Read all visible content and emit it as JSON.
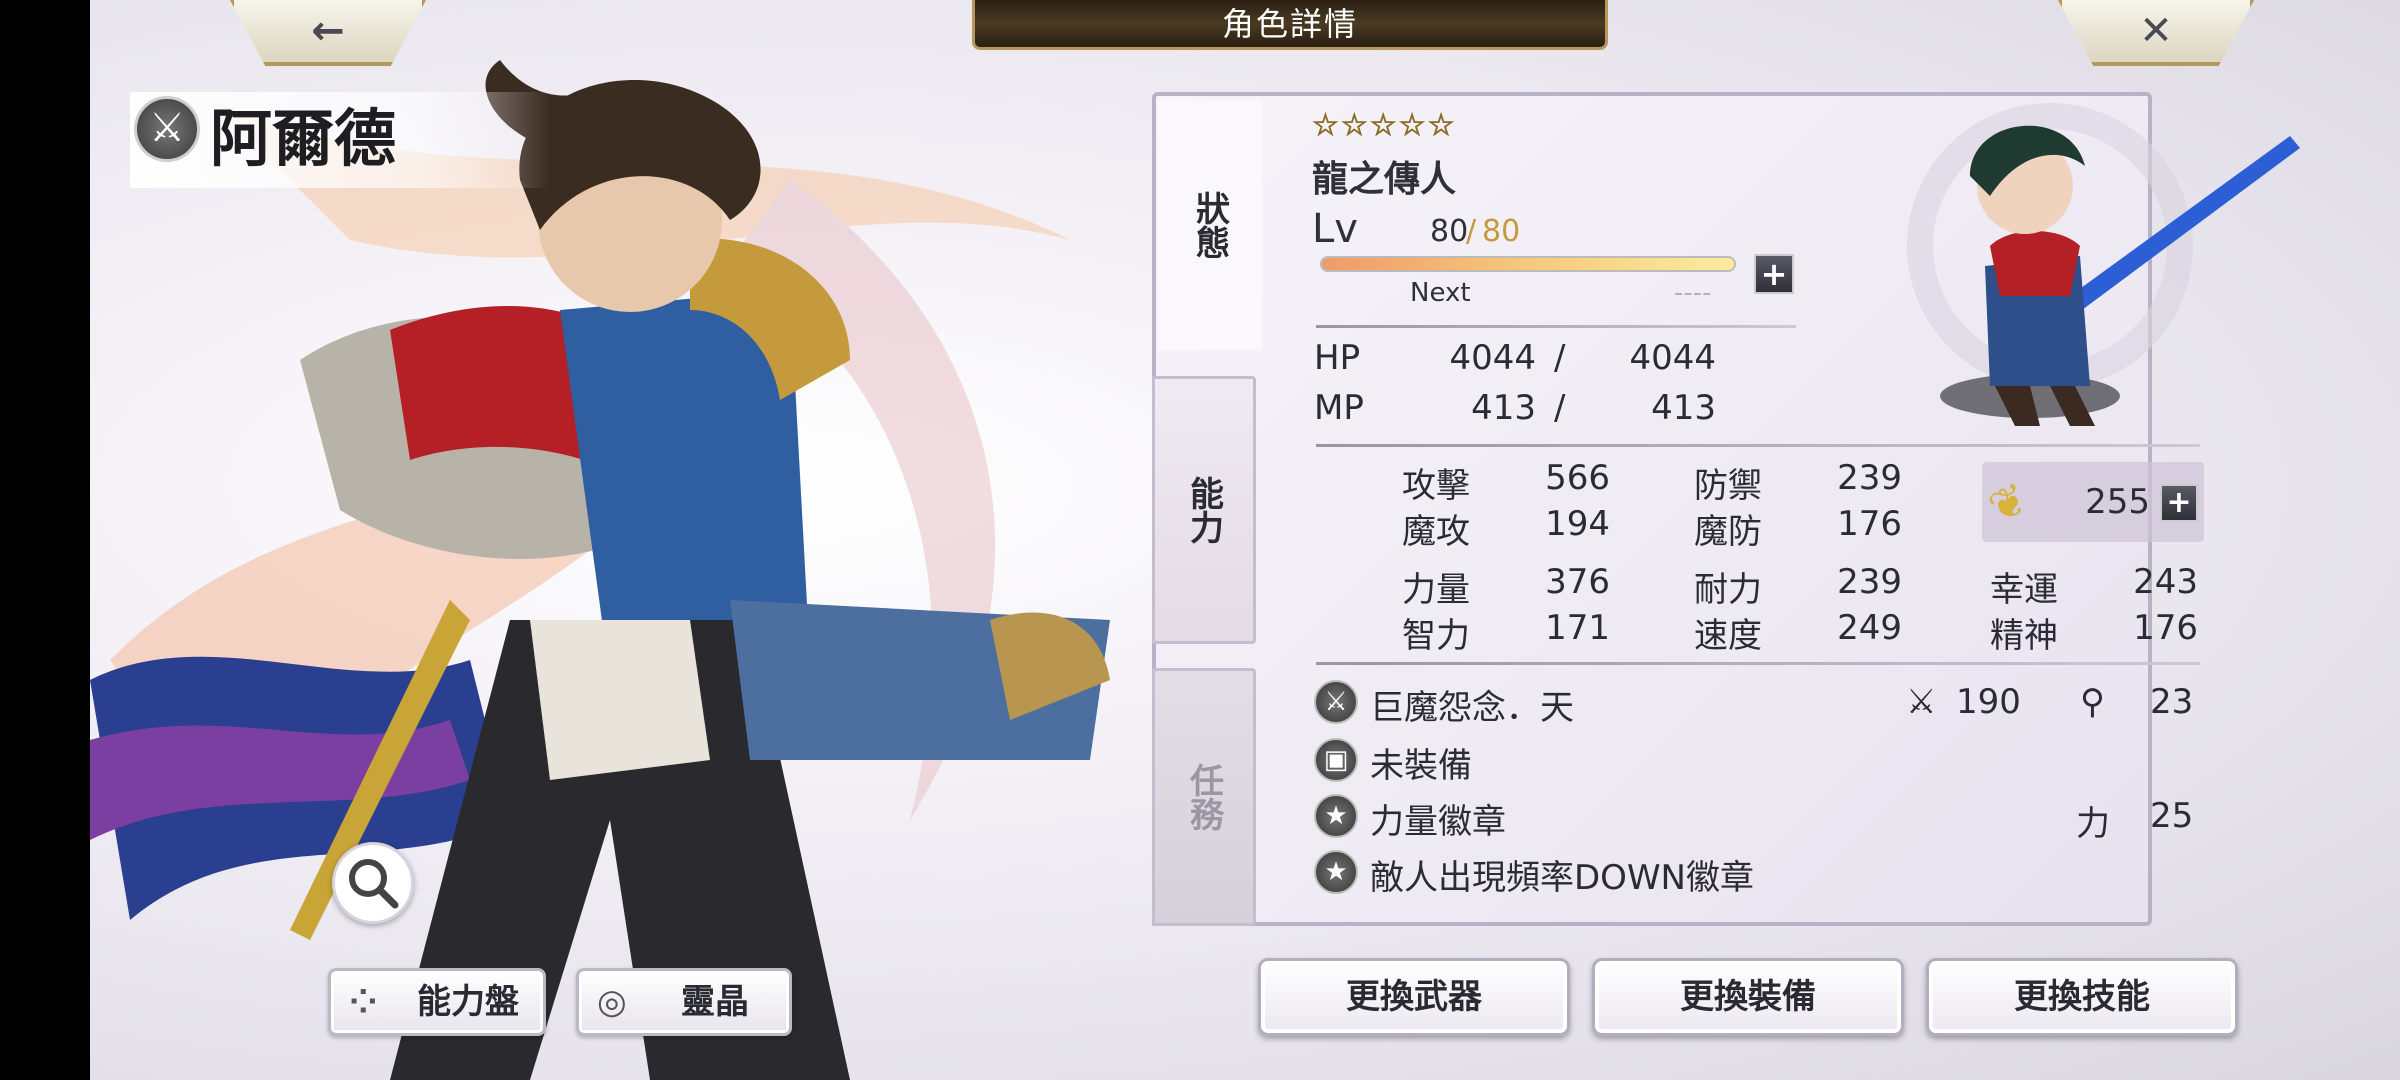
{
  "header": {
    "title": "角色詳情",
    "back_icon": "arrow-left-icon",
    "close_icon": "close-icon"
  },
  "character": {
    "name": "阿爾德",
    "rarity_stars": "☆☆☆☆☆",
    "job": "龍之傳人",
    "level_label": "Lv",
    "level_current": "80",
    "level_sep": "/",
    "level_max": "80",
    "exp_fill": 1.0,
    "next_label": "Next",
    "next_value": "----"
  },
  "tabs": {
    "status": "狀態",
    "ability": "能力",
    "quest": "任務"
  },
  "vitals": {
    "hp_label": "HP",
    "hp_current": "4044",
    "hp_sep": "/",
    "hp_max": "4044",
    "mp_label": "MP",
    "mp_current": "413",
    "mp_sep": "/",
    "mp_max": "413"
  },
  "stats": {
    "atk_label": "攻擊",
    "atk": "566",
    "def_label": "防禦",
    "def": "239",
    "mag_label": "魔攻",
    "mag": "194",
    "spr_label": "魔防",
    "spr": "176",
    "str_label": "力量",
    "str": "376",
    "vit_label": "耐力",
    "vit": "239",
    "luck_label": "幸運",
    "luck": "243",
    "int_label": "智力",
    "int": "171",
    "spd_label": "速度",
    "spd": "249",
    "mind_label": "精神",
    "mind": "176",
    "esper_value": "255"
  },
  "equipment": [
    {
      "icon": "sword-icon",
      "name": "巨魔怨念．天",
      "atk_icon": "sword-small-icon",
      "atk": "190",
      "mag_icon": "staff-small-icon",
      "mag": "23"
    },
    {
      "icon": "armor-icon",
      "name": "未裝備"
    },
    {
      "icon": "badge-icon",
      "name": "力量徽章",
      "bonus_label": "力",
      "bonus_value": "25"
    },
    {
      "icon": "badge-icon",
      "name": "敵人出現頻率DOWN徽章"
    }
  ],
  "buttons": {
    "ability_board": "能力盤",
    "crystal": "靈晶",
    "change_weapon": "更換武器",
    "change_equipment": "更換裝備",
    "change_skill": "更換技能"
  },
  "colors": {
    "accent_gold": "#b8975a",
    "level_max": "#c49a3c",
    "star": "#e0c36b"
  }
}
